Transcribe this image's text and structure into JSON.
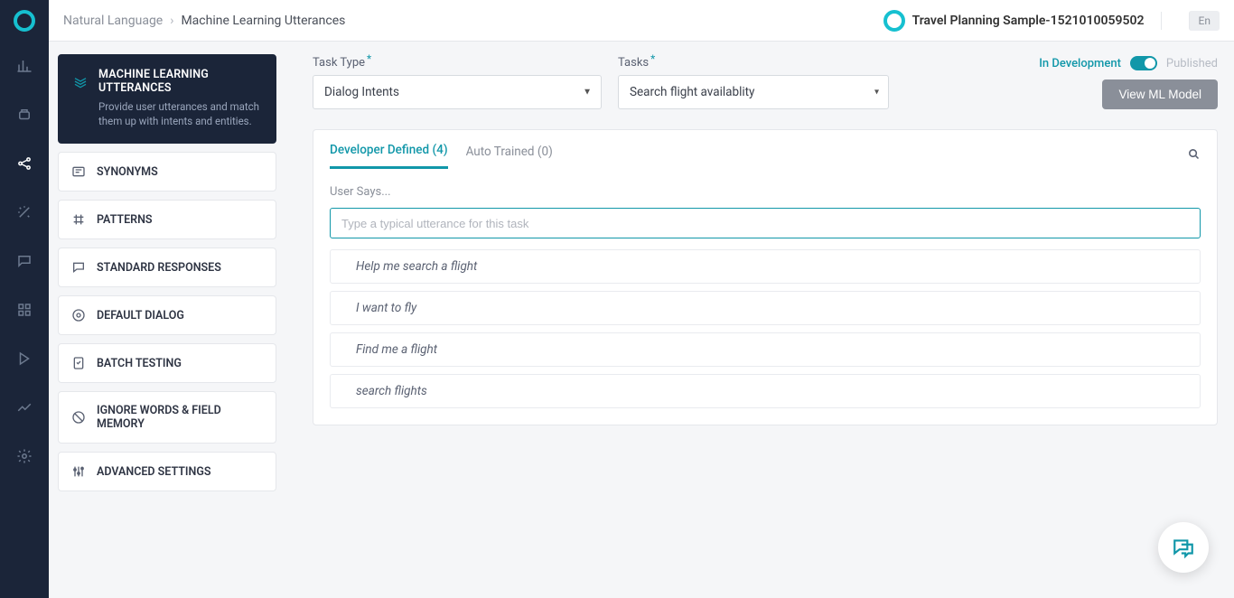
{
  "breadcrumb": {
    "parent": "Natural Language",
    "current": "Machine Learning Utterances"
  },
  "project": {
    "name": "Travel Planning Sample-1521010059502",
    "lang": "En"
  },
  "sidebar": {
    "items": [
      {
        "label": "MACHINE LEARNING UTTERANCES",
        "desc": "Provide user utterances and match them up with intents and entities."
      },
      {
        "label": "SYNONYMS"
      },
      {
        "label": "PATTERNS"
      },
      {
        "label": "STANDARD RESPONSES"
      },
      {
        "label": "DEFAULT DIALOG"
      },
      {
        "label": "BATCH TESTING"
      },
      {
        "label": "IGNORE WORDS & FIELD MEMORY"
      },
      {
        "label": "ADVANCED SETTINGS"
      }
    ]
  },
  "controls": {
    "taskType": {
      "label": "Task Type",
      "value": "Dialog Intents"
    },
    "tasks": {
      "label": "Tasks",
      "value": "Search flight availablity"
    }
  },
  "status": {
    "dev": "In Development",
    "pub": "Published"
  },
  "buttons": {
    "viewModel": "View ML Model"
  },
  "tabs": {
    "dev": "Developer Defined (4)",
    "auto": "Auto Trained (0)"
  },
  "userSays": {
    "label": "User Says...",
    "placeholder": "Type a typical utterance for this task"
  },
  "utterances": [
    "Help me search a flight",
    "I want to fly",
    "Find me a flight",
    "search flights"
  ]
}
